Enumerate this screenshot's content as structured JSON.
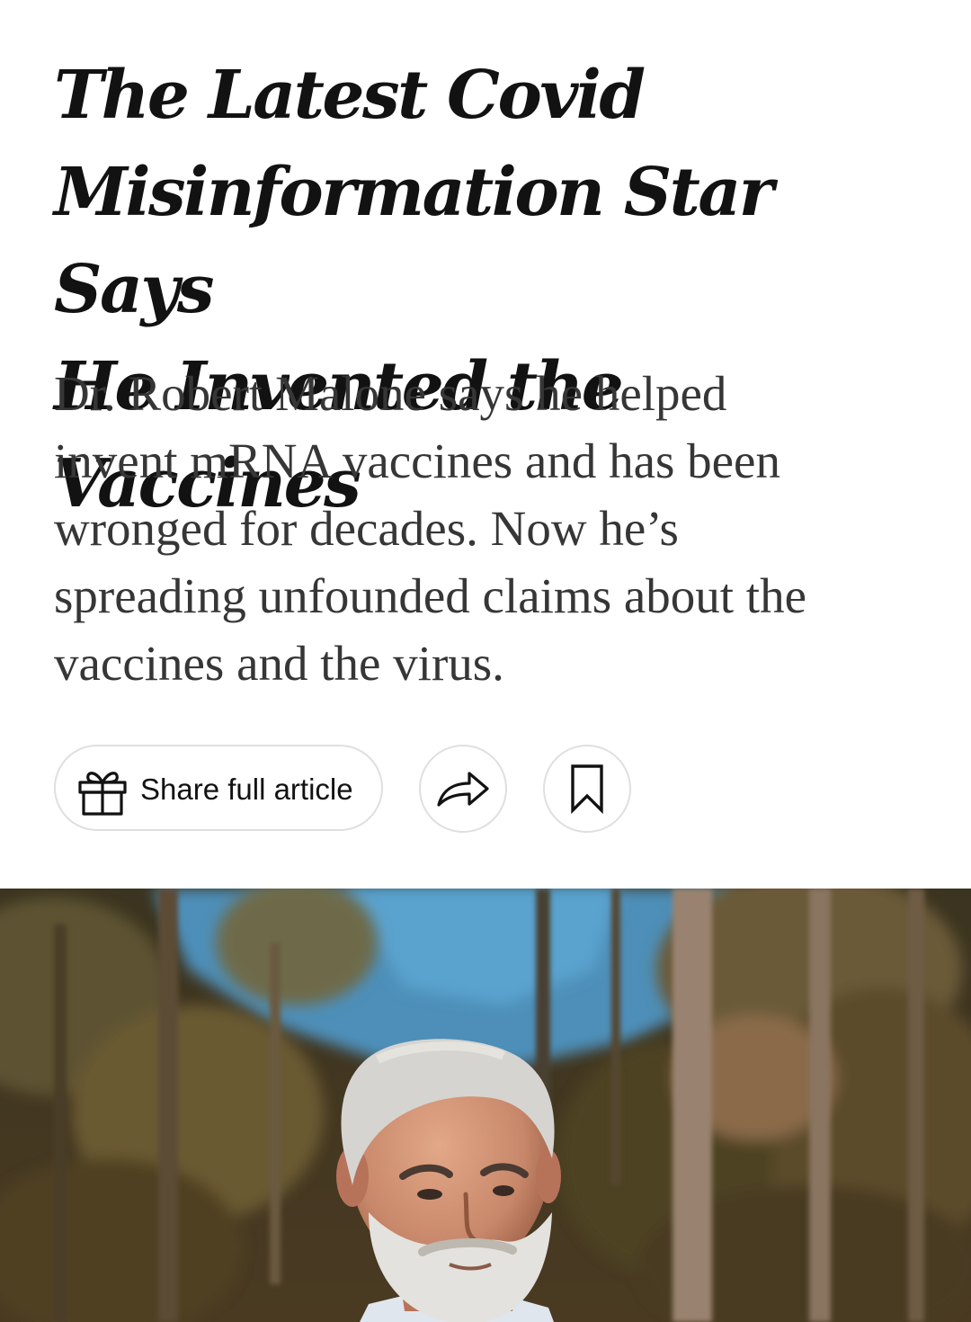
{
  "article": {
    "headline_lines": [
      "The Latest Covid",
      "Misinformation Star Says",
      "He Invented the Vaccines"
    ],
    "summary_lines": [
      "Dr. Robert Malone says he helped",
      "invent mRNA vaccines and has been",
      "wronged for decades. Now he’s",
      "spreading unfounded claims about the",
      "vaccines and the virus."
    ]
  },
  "actions": {
    "gift_share_label": "Share full article",
    "gift_icon": "gift-icon",
    "share_icon": "share-arrow-icon",
    "save_icon": "bookmark-icon"
  },
  "photo": {
    "subject": "man-with-gray-hair-and-beard-outdoors-among-trees"
  },
  "colors": {
    "headline": "#121212",
    "summary": "#363636",
    "button_border": "#dfdfdf"
  }
}
